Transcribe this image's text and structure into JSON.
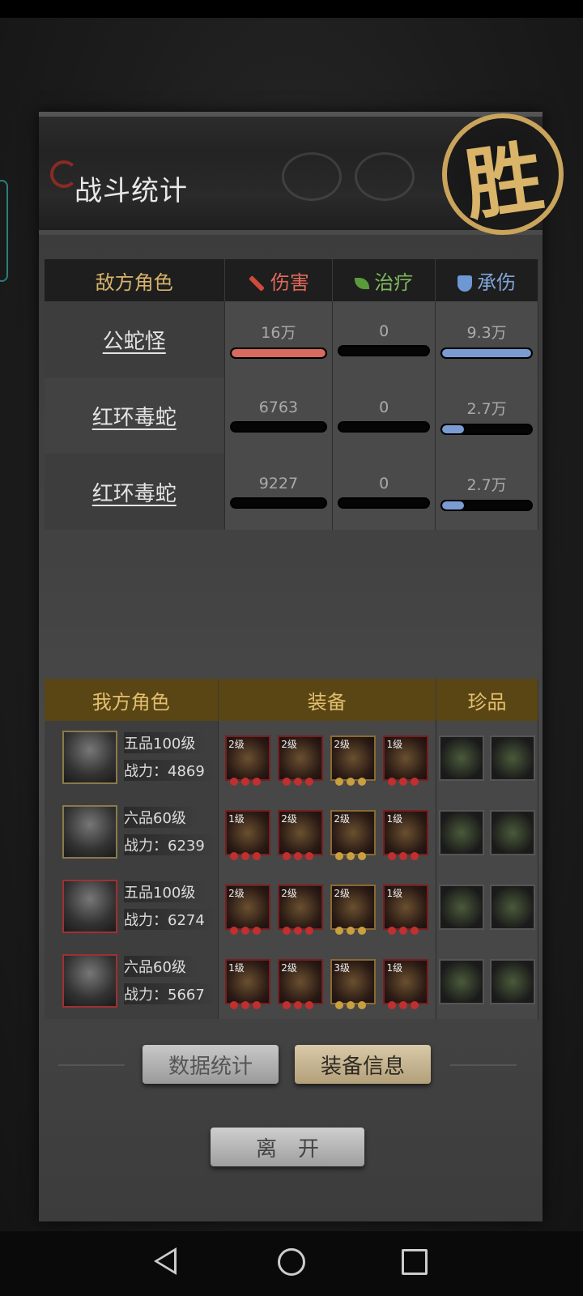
{
  "header": {
    "title": "战斗统计",
    "result_seal": "胜"
  },
  "enemy_table": {
    "columns": {
      "name": "敌方角色",
      "damage": "伤害",
      "heal": "治疗",
      "taken": "承伤"
    },
    "rows": [
      {
        "name": "公蛇怪",
        "damage": "16万",
        "damage_fill": 1.0,
        "heal": "0",
        "heal_fill": 0,
        "taken": "9.3万",
        "taken_fill": 1.0
      },
      {
        "name": "红环毒蛇",
        "damage": "6763",
        "damage_fill": 0,
        "heal": "0",
        "heal_fill": 0,
        "taken": "2.7万",
        "taken_fill": 0.24
      },
      {
        "name": "红环毒蛇",
        "damage": "9227",
        "damage_fill": 0,
        "heal": "0",
        "heal_fill": 0,
        "taken": "2.7万",
        "taken_fill": 0.24
      }
    ]
  },
  "ally_table": {
    "columns": {
      "name": "我方角色",
      "equipment": "装备",
      "treasure": "珍品"
    },
    "rows": [
      {
        "rank": "五品100级",
        "power": "战力：4869",
        "items": [
          "2级",
          "2级",
          "2级",
          "1级"
        ]
      },
      {
        "rank": "六品60级",
        "power": "战力：6239",
        "items": [
          "1级",
          "2级",
          "2级",
          "1级"
        ]
      },
      {
        "rank": "五品100级",
        "power": "战力：6274",
        "items": [
          "2级",
          "2级",
          "2级",
          "1级"
        ]
      },
      {
        "rank": "六品60级",
        "power": "战力：5667",
        "items": [
          "1级",
          "2级",
          "3级",
          "1级"
        ]
      }
    ]
  },
  "buttons": {
    "stats": "数据统计",
    "equipment_info": "装备信息",
    "leave": "离开"
  },
  "colors": {
    "damage": "#d86a5e",
    "taken": "#7b9cd2",
    "gold": "#d8b36a",
    "ally_header": "#5a4514"
  }
}
